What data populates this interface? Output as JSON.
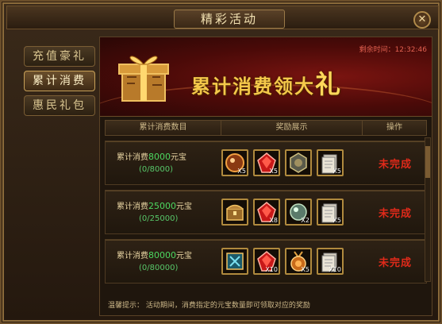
{
  "window": {
    "title": "精彩活动",
    "close_label": "✕"
  },
  "sidebar": {
    "tabs": [
      {
        "label": "充值豪礼",
        "active": false
      },
      {
        "label": "累计消费",
        "active": true
      },
      {
        "label": "惠民礼包",
        "active": false
      }
    ]
  },
  "banner": {
    "title": "累计消费领大",
    "title_last": "礼",
    "timer": "剩余时间：12:32:46"
  },
  "table": {
    "headers": [
      "累计消费数目",
      "奖励展示",
      "操作"
    ],
    "rows": [
      {
        "label": "累计消费",
        "amount": "8000",
        "unit": "元宝",
        "progress": "(0/8000)",
        "items": [
          {
            "icon": "orb-icon",
            "qty": "X5"
          },
          {
            "icon": "ruby-gem-icon",
            "qty": "X5"
          },
          {
            "icon": "emblem-icon",
            "qty": ""
          },
          {
            "icon": "scroll-icon",
            "qty": "X5"
          }
        ],
        "status": "未完成"
      },
      {
        "label": "累计消费",
        "amount": "25000",
        "unit": "元宝",
        "progress": "(0/25000)",
        "items": [
          {
            "icon": "chest-icon",
            "qty": ""
          },
          {
            "icon": "ruby-gem-icon",
            "qty": "X8"
          },
          {
            "icon": "pearl-icon",
            "qty": "X2"
          },
          {
            "icon": "scroll-icon",
            "qty": "X5"
          }
        ],
        "status": "未完成"
      },
      {
        "label": "累计消费",
        "amount": "80000",
        "unit": "元宝",
        "progress": "(0/80000)",
        "items": [
          {
            "icon": "jade-token-icon",
            "qty": ""
          },
          {
            "icon": "ruby-gem-icon",
            "qty": "X10"
          },
          {
            "icon": "medal-icon",
            "qty": "X5"
          },
          {
            "icon": "scroll-icon",
            "qty": "X10"
          }
        ],
        "status": "未完成"
      }
    ]
  },
  "tip": "温馨提示： 活动期间，消费指定的元宝数量即可领取对应的奖励",
  "colors": {
    "accent": "#f4c84a",
    "status": "#e02a1a",
    "progress": "#4cd860"
  }
}
